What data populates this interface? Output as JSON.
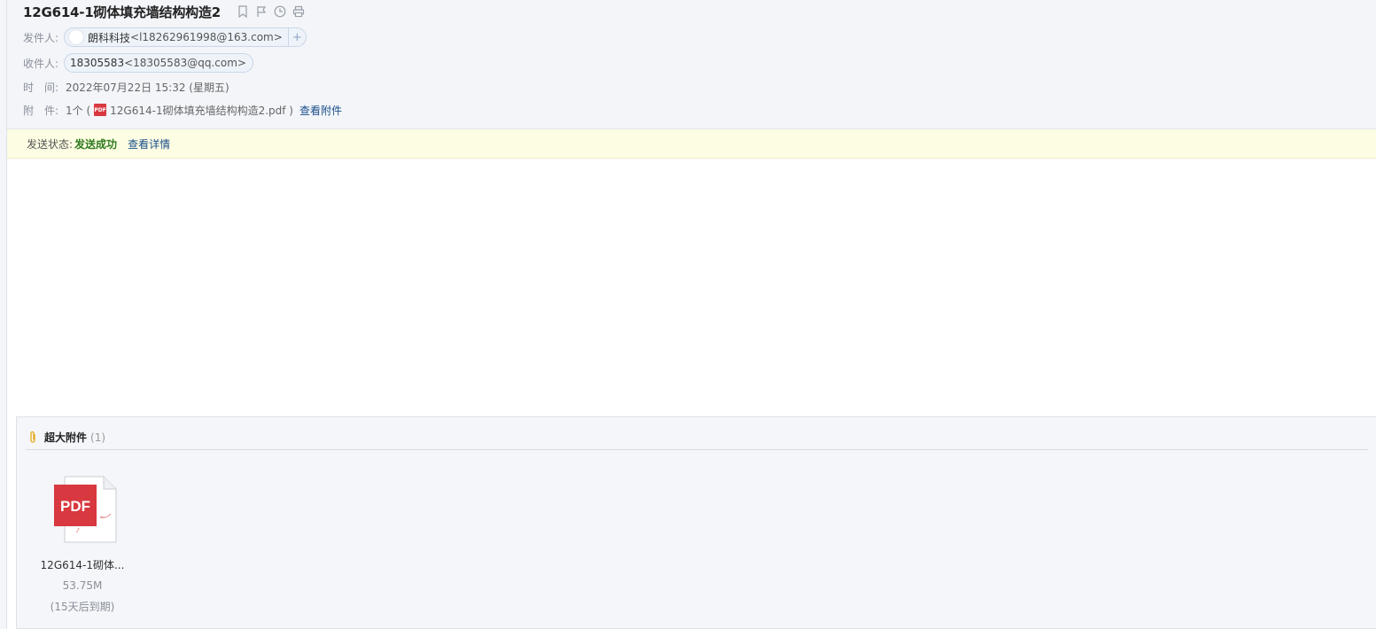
{
  "mail": {
    "subject": "12G614-1砌体填充墙结构构造2",
    "from_label": "发件人:",
    "from_name": "朗科科技",
    "from_addr": "<l18262961998@163.com>",
    "to_label": "收件人:",
    "to_name": "18305583",
    "to_addr": "<18305583@qq.com>",
    "time_label": "时　间:",
    "time_value": "2022年07月22日 15:32 (星期五)",
    "attach_label": "附　件:",
    "attach_count": "1个 (",
    "attach_file": "12G614-1砌体填充墙结构构造2.pdf )",
    "attach_view": "查看附件",
    "plus": "+"
  },
  "status": {
    "label": "发送状态:",
    "value": "发送成功",
    "detail_link": "查看详情"
  },
  "big_attachments": {
    "title": "超大附件",
    "count": "(1)",
    "items": [
      {
        "name": "12G614-1砌体...",
        "size": "53.75M",
        "expire": "(15天后到期)",
        "badge": "PDF"
      }
    ]
  },
  "icons": [
    "bookmark-icon",
    "flag-icon",
    "clock-icon",
    "print-icon",
    "paperclip-icon",
    "pdf-file-icon"
  ],
  "colors": {
    "link": "#1a4e8a",
    "success": "#2f7a1f",
    "pdf_red": "#d8383f",
    "status_bg": "#fdfde3"
  }
}
